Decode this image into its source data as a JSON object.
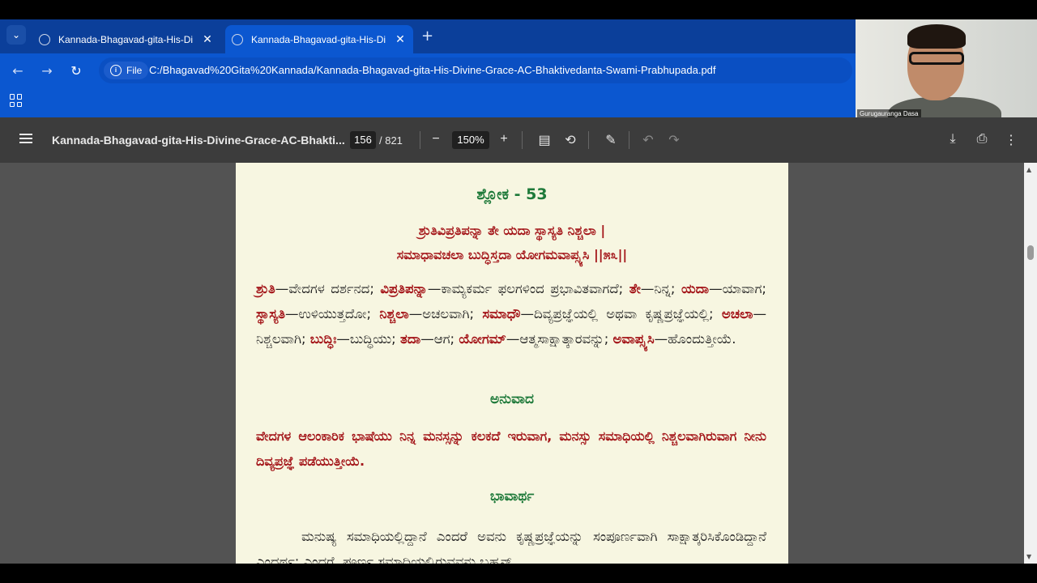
{
  "browser": {
    "tabs": [
      {
        "title": "Kannada-Bhagavad-gita-His-Di"
      },
      {
        "title": "Kannada-Bhagavad-gita-His-Di"
      }
    ],
    "new_tab": "+",
    "file_chip": "File",
    "url": "C:/Bhagavad%20Gita%20Kannada/Kannada-Bhagavad-gita-His-Divine-Grace-AC-Bhaktivedanta-Swami-Prabhupada.pdf"
  },
  "webcam": {
    "name": "Gurugauranga Dasa"
  },
  "pdf_toolbar": {
    "title": "Kannada-Bhagavad-gita-His-Divine-Grace-AC-Bhakti...",
    "page_current": "156",
    "page_total": "/ 821",
    "zoom": "150%"
  },
  "page": {
    "heading": "ಶ್ಲೋಕ - 53",
    "verse_line1": "ಶ್ರುತಿವಿಪ್ರತಿಪನ್ನಾ ತೇ ಯದಾ ಸ್ಥಾಸ್ಯತಿ ನಿಶ್ಚಲಾ |",
    "verse_line2": "ಸಮಾಧಾವಚಲಾ ಬುದ್ಧಿಸ್ತದಾ ಯೋಗಮವಾಪ್ಸ್ಯಸಿ ||೫೩||",
    "synonyms": [
      {
        "w": "ಶ್ರುತಿ",
        "m": "—ವೇದಗಳ ದರ್ಶನದ; "
      },
      {
        "w": "ವಿಪ್ರತಿಪನ್ನಾ",
        "m": "—ಕಾಮ್ಯಕರ್ಮ ಫಲಗಳಿಂದ ಪ್ರಭಾವಿತವಾಗದೆ; "
      },
      {
        "w": "ತೇ",
        "m": "—ನಿನ್ನ; "
      },
      {
        "w": "ಯದಾ",
        "m": "—ಯಾವಾಗ; "
      },
      {
        "w": "ಸ್ಥಾಸ್ಯತಿ",
        "m": "—ಉಳಿಯುತ್ತದೋ; "
      },
      {
        "w": "ನಿಶ್ಚಲಾ",
        "m": "—ಅಚಲವಾಗಿ; "
      },
      {
        "w": "ಸಮಾಧೌ",
        "m": "—ದಿವ್ಯಪ್ರಜ್ಞೆಯಲ್ಲಿ ಅಥವಾ ಕೃಷ್ಣಪ್ರಜ್ಞೆಯಲ್ಲಿ; "
      },
      {
        "w": "ಅಚಲಾ",
        "m": "—ನಿಶ್ಚಲವಾಗಿ; "
      },
      {
        "w": "ಬುದ್ಧಿಃ",
        "m": "—ಬುದ್ಧಿಯು; "
      },
      {
        "w": "ತದಾ",
        "m": "—ಆಗ; "
      },
      {
        "w": "ಯೋಗಮ್",
        "m": "—ಆತ್ಮಸಾಕ್ಷಾತ್ಕಾರವನ್ನು; "
      },
      {
        "w": "ಅವಾಪ್ಸ್ಯಸಿ",
        "m": "—ಹೊಂದುತ್ತೀಯೆ."
      }
    ],
    "anuvada_heading": "ಅನುವಾದ",
    "translation": "ವೇದಗಳ ಆಲಂಕಾರಿಕ ಭಾಷೆಯು ನಿನ್ನ ಮನಸ್ಸನ್ನು ಕಲಕದೆ ಇರುವಾಗ, ಮನಸ್ಸು ಸಮಾಧಿಯಲ್ಲಿ ನಿಶ್ಚಲವಾಗಿರುವಾಗ ನೀನು ದಿವ್ಯಪ್ರಜ್ಞೆ ಪಡೆಯುತ್ತೀಯೆ.",
    "bhavartha_heading": "ಭಾವಾರ್ಥ",
    "purport": "ಮನುಷ್ಯ ಸಮಾಧಿಯಲ್ಲಿದ್ದಾನೆ ಎಂದರೆ ಅವನು ಕೃಷ್ಣಪ್ರಜ್ಞೆಯನ್ನು ಸಂಪೂರ್ಣವಾಗಿ ಸಾಕ್ಷಾತ್ಕರಿಸಿಕೊಂಡಿದ್ದಾನೆ ಎಂದರ್ಥ; ಎಂದರೆ, ಪೂರ್ಣ ಸಮಾಧಿಯಲ್ಲಿರುವವನು ಬ್ರಹ್ಮನ್,"
  }
}
